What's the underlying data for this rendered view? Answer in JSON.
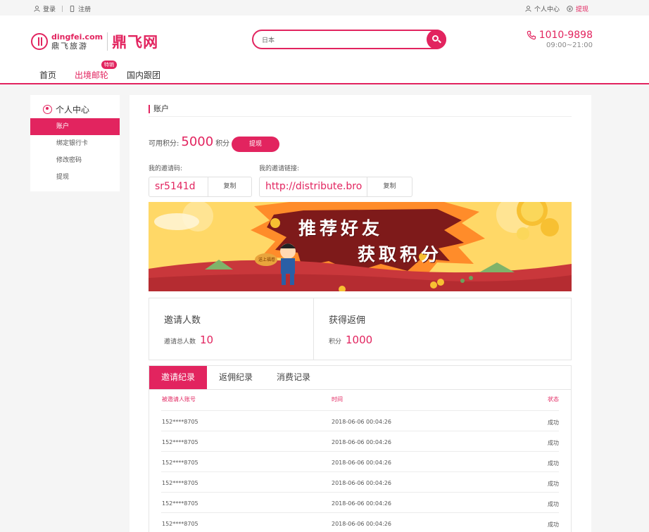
{
  "topbar": {
    "login": "登录",
    "separator": "|",
    "register": "注册",
    "user_center": "个人中心",
    "withdraw": "提现"
  },
  "brand": {
    "domain": "dingfei.com",
    "name_cn": "鼎飞旅游",
    "brand_name": "鼎飞网"
  },
  "search": {
    "value": "日本"
  },
  "contact": {
    "phone": "1010-9898",
    "hours": "09:00~21:00"
  },
  "nav": {
    "items": [
      "首页",
      "出境邮轮",
      "国内跟团"
    ],
    "badge": "特销"
  },
  "sidebar": {
    "title": "个人中心",
    "items": [
      "账户",
      "绑定银行卡",
      "修改密码",
      "提现"
    ]
  },
  "account": {
    "title": "账户",
    "points_label": "可用积分:",
    "points_value": "5000",
    "points_unit": "积分",
    "withdraw_label": "提现",
    "invite_code_label": "我的邀请码:",
    "invite_code": "sr5141d",
    "invite_link_label": "我的邀请链接:",
    "invite_link": "http://distribute.bro",
    "copy_label": "复制"
  },
  "banner": {
    "line1": "推荐好友",
    "line2": "获取积分",
    "bubble": "送上福卷",
    "colors": {
      "sky": "#ffd867",
      "burst": "#ff8c2a",
      "panel": "#7e1a1a",
      "ground": "#c9373b"
    }
  },
  "stats": {
    "invite_title": "邀请人数",
    "invite_label": "邀请总人数",
    "invite_value": "10",
    "rebate_title": "获得返佣",
    "rebate_label": "积分",
    "rebate_value": "1000"
  },
  "records": {
    "tabs": [
      "邀请纪录",
      "返佣纪录",
      "消费记录"
    ],
    "columns": [
      "被邀请人账号",
      "时间",
      "状态"
    ],
    "rows": [
      [
        "152****8705",
        "2018-06-06 00:04:26",
        "成功"
      ],
      [
        "152****8705",
        "2018-06-06 00:04:26",
        "成功"
      ],
      [
        "152****8705",
        "2018-06-06 00:04:26",
        "成功"
      ],
      [
        "152****8705",
        "2018-06-06 00:04:26",
        "成功"
      ],
      [
        "152****8705",
        "2018-06-06 00:04:26",
        "成功"
      ],
      [
        "152****8705",
        "2018-06-06 00:04:26",
        "成功"
      ]
    ]
  },
  "theme": {
    "accent": "#e2245f"
  }
}
